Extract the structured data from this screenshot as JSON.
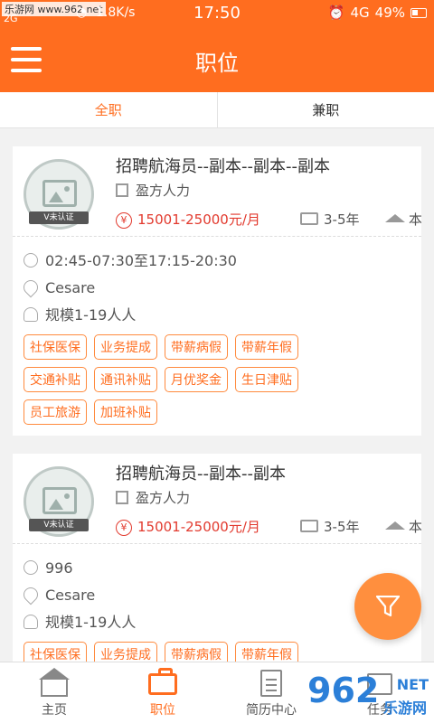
{
  "status_bar": {
    "watermark_site": "乐游网 www.962.net",
    "network": "2G",
    "speed": "1.8K/s",
    "time": "17:50",
    "signal": "4G",
    "battery": "49%"
  },
  "header": {
    "title": "职位"
  },
  "tabs": [
    {
      "label": "全职",
      "active": true
    },
    {
      "label": "兼职",
      "active": false
    }
  ],
  "jobs": [
    {
      "title": "招聘航海员--副本--副本--副本",
      "company": "盈方人力",
      "badge": "V未认证",
      "salary": "15001-25000元/月",
      "experience": "3-5年",
      "education": "本",
      "hours": "02:45-07:30至17:15-20:30",
      "location": "Cesare",
      "scale": "规模1-19人人",
      "tags": [
        "社保医保",
        "业务提成",
        "带薪病假",
        "带薪年假",
        "交通补贴",
        "通讯补贴",
        "月优奖金",
        "生日津贴",
        "员工旅游",
        "加班补贴"
      ]
    },
    {
      "title": "招聘航海员--副本--副本",
      "company": "盈方人力",
      "badge": "V未认证",
      "salary": "15001-25000元/月",
      "experience": "3-5年",
      "education": "本",
      "hours": "996",
      "location": "Cesare",
      "scale": "规模1-19人人",
      "tags": [
        "社保医保",
        "业务提成",
        "带薪病假",
        "带薪年假"
      ]
    }
  ],
  "bottom_nav": [
    {
      "label": "主页",
      "icon": "home-icon",
      "active": false
    },
    {
      "label": "职位",
      "icon": "briefcase-icon",
      "active": true
    },
    {
      "label": "简历中心",
      "icon": "resume-icon",
      "active": false
    },
    {
      "label": "任务",
      "icon": "calendar-icon",
      "active": false
    }
  ],
  "watermark": {
    "brand": "962",
    "suffix": "NET",
    "sub": "乐游网"
  },
  "colors": {
    "primary": "#ff6d1f",
    "salary": "#e23a2e",
    "fab": "#ff8f3e"
  }
}
